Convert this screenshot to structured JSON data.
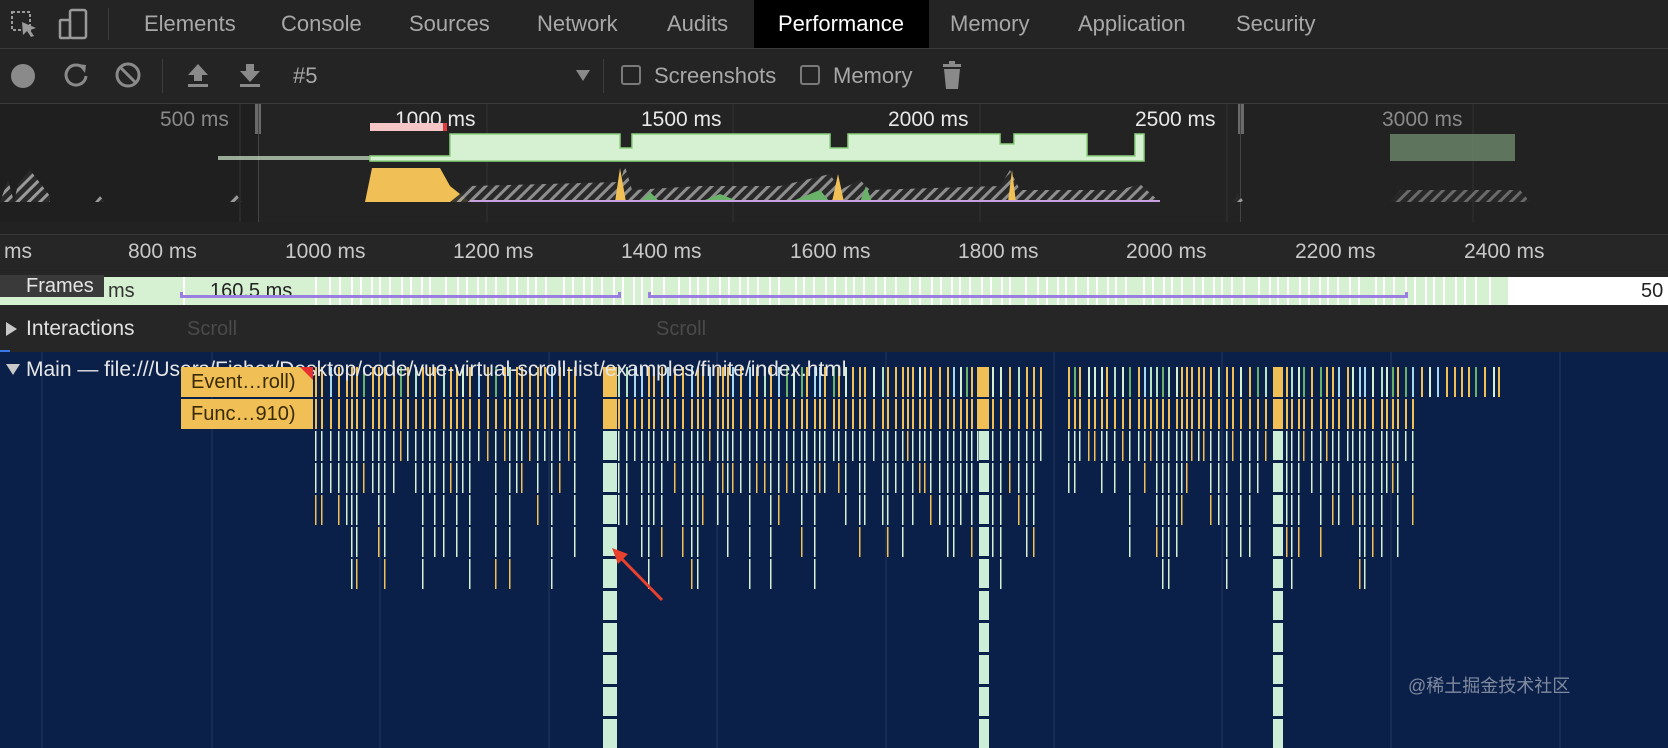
{
  "tabs": [
    "Elements",
    "Console",
    "Sources",
    "Network",
    "Audits",
    "Performance",
    "Memory",
    "Application",
    "Security"
  ],
  "active_tab": "Performance",
  "toolbar": {
    "recording_select": "#5",
    "screenshots_label": "Screenshots",
    "screenshots_checked": false,
    "memory_label": "Memory",
    "memory_checked": false
  },
  "overview": {
    "ticks": [
      "500 ms",
      "1000 ms",
      "1500 ms",
      "2000 ms",
      "2500 ms",
      "3000 ms"
    ]
  },
  "ruler": {
    "ticks": [
      "ms",
      "800 ms",
      "1000 ms",
      "1200 ms",
      "1400 ms",
      "1600 ms",
      "1800 ms",
      "2000 ms",
      "2200 ms",
      "2400 ms"
    ]
  },
  "frames": {
    "label": "Frames",
    "prefix": "ms",
    "duration": "160.5 ms",
    "right_value": "50"
  },
  "interactions": {
    "label": "Interactions",
    "events": [
      "Scroll",
      "Scroll"
    ]
  },
  "main": {
    "title": "Main — file:///Users/Fisher/Desktop/code/vue-virtual-scroll-list/examples/finite/index.html",
    "event_label": "Event…roll)",
    "function_label": "Func…910)"
  },
  "watermark": "@稀土掘金技术社区",
  "colors": {
    "active_tab_bg": "#000000",
    "frame_green": "#d6f0d2",
    "scripting_yellow": "#f0c056",
    "main_bg": "#0b2048",
    "interaction_purple": "#9a7fe0",
    "arrow_red": "#e8412e"
  }
}
